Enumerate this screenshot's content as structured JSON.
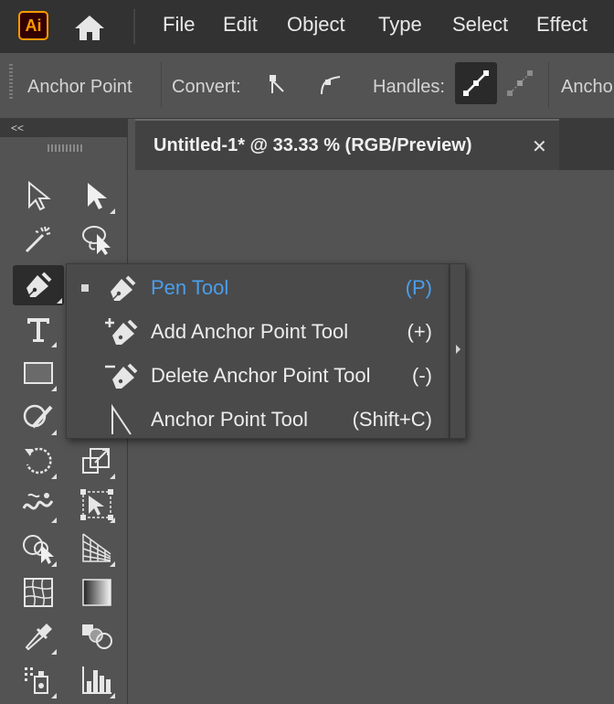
{
  "app": {
    "logo_text": "Ai",
    "accent": "#ff9a00"
  },
  "menubar": {
    "items": [
      "File",
      "Edit",
      "Object",
      "Type",
      "Select",
      "Effect"
    ]
  },
  "controlbar": {
    "tool_name": "Anchor Point",
    "convert_label": "Convert:",
    "handles_label": "Handles:",
    "anchors_label": "Anchor"
  },
  "tools_panel": {
    "collapse_glyph": "<<"
  },
  "document": {
    "tab_title": "Untitled-1* @ 33.33 % (RGB/Preview)",
    "close_glyph": "✕"
  },
  "flyout": {
    "items": [
      {
        "label": "Pen Tool",
        "shortcut": "(P)",
        "icon": "pen-icon",
        "active": true
      },
      {
        "label": "Add Anchor Point Tool",
        "shortcut": "(+)",
        "icon": "add-anchor-point-icon",
        "active": false
      },
      {
        "label": "Delete Anchor Point Tool",
        "shortcut": "(-)",
        "icon": "delete-anchor-point-icon",
        "active": false
      },
      {
        "label": "Anchor Point Tool",
        "shortcut": "(Shift+C)",
        "icon": "anchor-point-icon",
        "active": false
      }
    ],
    "active_color": "#4a9eec"
  }
}
